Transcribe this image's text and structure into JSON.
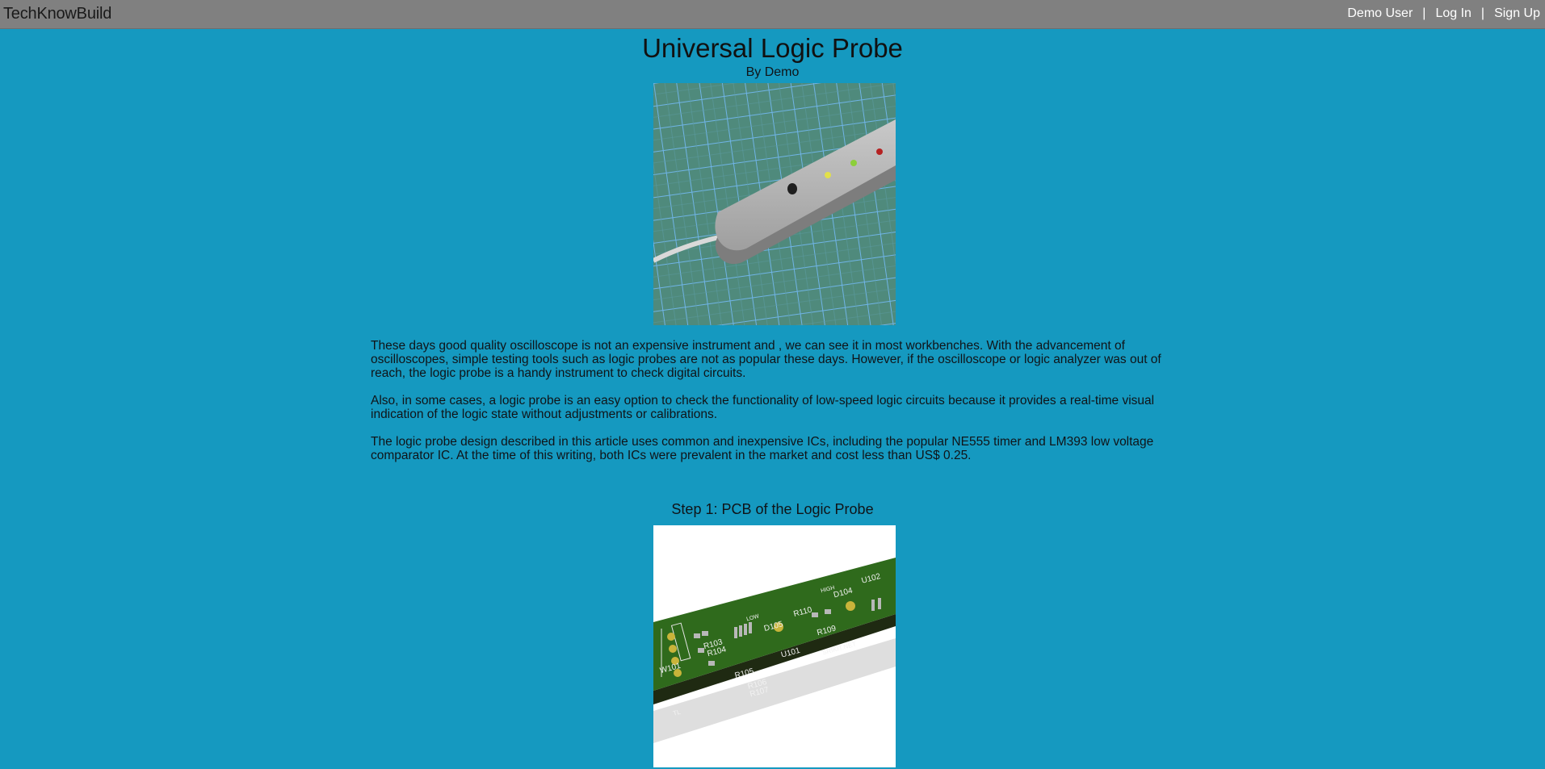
{
  "header": {
    "brand": "TechKnowBuild",
    "nav": {
      "user": "Demo User",
      "login": "Log In",
      "signup": "Sign Up",
      "separator": "|"
    }
  },
  "article": {
    "title": "Universal Logic Probe",
    "byline": "By Demo",
    "paragraphs": [
      "These days good quality oscilloscope is not an expensive instrument and , we can see it in most workbenches. With the advancement of oscilloscopes, simple testing tools such as logic probes are not as popular these days. However, if the oscilloscope or logic analyzer was out of reach, the logic probe is a handy instrument to check digital circuits.",
      "Also, in some cases, a logic probe is an easy option to check the functionality of low-speed logic circuits because it provides a real-time visual indication of the logic state without adjustments or calibrations.",
      "The logic probe design described in this article uses common and inexpensive ICs, including the popular NE555 timer and LM393 low voltage comparator IC. At the time of this writing, both ICs were prevalent in the market and cost less than US$ 0.25."
    ],
    "step1": {
      "title": "Step 1: PCB of the Logic Probe",
      "pcb_labels": [
        "W101",
        "R103",
        "R104",
        "LOW",
        "D105",
        "R110",
        "HIGH",
        "D104",
        "U102",
        "R105",
        "U101",
        "R109",
        "R106",
        "R107",
        "SRIKIT.NET",
        "TL"
      ]
    }
  },
  "colors": {
    "page_bg": "#1599c0",
    "topbar_bg": "#808080",
    "nav_text": "#ffffff"
  }
}
